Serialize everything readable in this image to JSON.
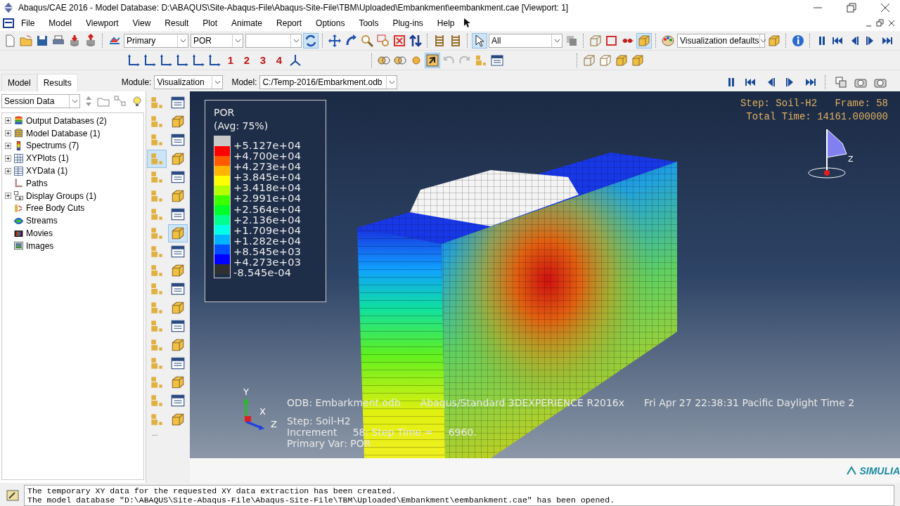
{
  "window": {
    "title": "Abaqus/CAE 2016 - Model Database: D:\\ABAQUS\\Site-Abaqus-File\\Abaqus-Site-File\\TBM\\Uploaded\\Embankment\\eembankment.cae [Viewport: 1]"
  },
  "menu": [
    "File",
    "Model",
    "Viewport",
    "View",
    "Result",
    "Plot",
    "Animate",
    "Report",
    "Options",
    "Tools",
    "Plug-ins",
    "Help"
  ],
  "toolbar": {
    "step_dropdown": "Primary",
    "variable_dropdown": "POR",
    "selection_dropdown": "All",
    "display_options_dropdown": "Visualization defaults",
    "view_numbers": [
      "1",
      "2",
      "3",
      "4"
    ]
  },
  "tabs": [
    {
      "label": "Model",
      "selected": false
    },
    {
      "label": "Results",
      "selected": true
    }
  ],
  "context_bar": {
    "module_label": "Module:",
    "module": "Visualization",
    "model_label": "Model:",
    "model": "C:/Temp-2016/Embarkment.odb"
  },
  "session": {
    "dropdown": "Session Data",
    "items": [
      {
        "label": "Output Databases (2)",
        "expandable": true,
        "kind": "odb"
      },
      {
        "label": "Model Database (1)",
        "expandable": true,
        "kind": "mdb"
      },
      {
        "label": "Spectrums (7)",
        "expandable": true,
        "kind": "spectrum"
      },
      {
        "label": "XYPlots (1)",
        "expandable": true,
        "kind": "xyplot"
      },
      {
        "label": "XYData (1)",
        "expandable": true,
        "kind": "xydata"
      },
      {
        "label": "Paths",
        "expandable": false,
        "kind": "path"
      },
      {
        "label": "Display Groups (1)",
        "expandable": true,
        "kind": "group"
      },
      {
        "label": "Free Body Cuts",
        "expandable": false,
        "kind": "cut"
      },
      {
        "label": "Streams",
        "expandable": false,
        "kind": "stream"
      },
      {
        "label": "Movies",
        "expandable": false,
        "kind": "movie"
      },
      {
        "label": "Images",
        "expandable": false,
        "kind": "image"
      }
    ]
  },
  "toolbox": [
    {
      "selected": false
    },
    {
      "selected": false
    },
    {
      "selected": false
    },
    {
      "selected": false
    },
    {
      "selected": false
    },
    {
      "selected": false
    },
    {
      "selected": true
    },
    {
      "selected": false
    },
    {
      "selected": false
    },
    {
      "selected": false
    },
    {
      "selected": false
    },
    {
      "selected": false
    },
    {
      "selected": false
    },
    {
      "selected": false
    },
    {
      "selected": false
    },
    {
      "selected": true
    },
    {
      "selected": false
    },
    {
      "selected": false
    },
    {
      "selected": false
    },
    {
      "selected": false
    },
    {
      "selected": false
    },
    {
      "selected": false
    },
    {
      "selected": false
    },
    {
      "selected": false
    },
    {
      "selected": false
    },
    {
      "selected": false
    },
    {
      "selected": false
    },
    {
      "selected": false
    },
    {
      "selected": false
    },
    {
      "selected": false
    },
    {
      "selected": false
    },
    {
      "selected": false
    },
    {
      "selected": false
    },
    {
      "selected": false
    },
    {
      "selected": false
    },
    {
      "selected": false
    }
  ],
  "toolbox_more": "...",
  "viewport": {
    "legend": {
      "title": "POR",
      "subtitle": "(Avg: 75%)",
      "labels": [
        "+5.127e+04",
        "+4.700e+04",
        "+4.273e+04",
        "+3.845e+04",
        "+3.418e+04",
        "+2.991e+04",
        "+2.564e+04",
        "+2.136e+04",
        "+1.709e+04",
        "+1.282e+04",
        "+8.545e+03",
        "+4.273e+03",
        "-8.545e-04"
      ],
      "bands": [
        {
          "color": "#c8c8c8"
        },
        {
          "color": "#ff0000"
        },
        {
          "color": "#ff5a00"
        },
        {
          "color": "#ffb400"
        },
        {
          "color": "#ffff00"
        },
        {
          "color": "#b4ff00"
        },
        {
          "color": "#3cff00"
        },
        {
          "color": "#00ff28"
        },
        {
          "color": "#00ff8c"
        },
        {
          "color": "#00ffe6"
        },
        {
          "color": "#00b4ff"
        },
        {
          "color": "#0050ff"
        },
        {
          "color": "#0000ff"
        },
        {
          "color": "#303030"
        }
      ]
    },
    "step_frame": "Step: Soil-H2   Frame: 58",
    "total_time": "Total Time: 14161.000000",
    "view_triad_label": "Z",
    "triad_labels": [
      "Y",
      "X",
      "Z"
    ],
    "info": {
      "odb": "ODB: Embarkment.odb",
      "solver": "Abaqus/Standard 3DEXPERIENCE R2016x",
      "date": "Fri Apr 27 22:38:31 Pacific Daylight Time 2",
      "step": "Step: Soil-H2",
      "increment": "Increment     58: Step Time =     6960.",
      "primary_var": "Primary Var: POR"
    }
  },
  "logo": "SIMULIA",
  "messages": [
    "The temporary XY data for the requested XY data extraction has been created.",
    "The model database \"D:\\ABAQUS\\Site-Abaqus-File\\Abaqus-Site-File\\TBM\\Uploaded\\Embankment\\eembankment.cae\" has been opened."
  ]
}
